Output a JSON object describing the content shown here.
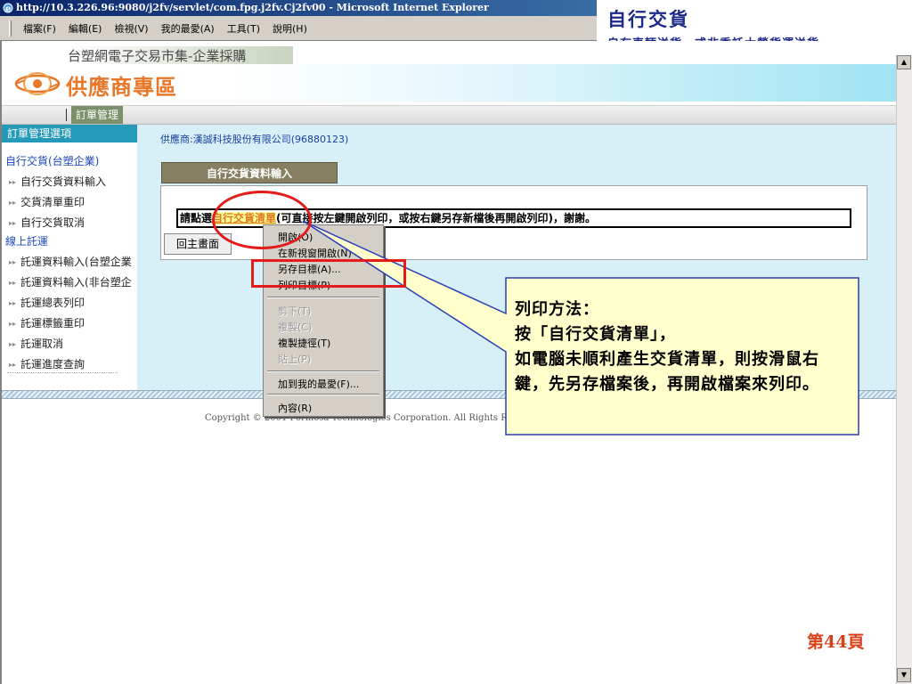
{
  "window": {
    "title": "http://10.3.226.96:9080/j2fv/servlet/com.fpg.j2fv.Cj2fv00 - Microsoft Internet Explorer"
  },
  "menubar": {
    "items": [
      "檔案(F)",
      "編輯(E)",
      "檢視(V)",
      "我的最愛(A)",
      "工具(T)",
      "說明(H)"
    ]
  },
  "slide": {
    "title": "自行交貨",
    "subtitle": "自有車輛送貨、或非委託大榮貨運送貨",
    "page_number": "第44頁"
  },
  "header": {
    "market_title": "台塑網電子交易市集-企業採購",
    "zone_title": "供應商專區",
    "nav_tab": "訂單管理"
  },
  "sidebar": {
    "header": "訂單管理選項",
    "cat1": "自行交貨(台塑企業)",
    "cat1_items": [
      "自行交貨資料輸入",
      "交貨清單重印",
      "自行交貨取消"
    ],
    "cat2": "線上託運",
    "cat2_items": [
      "託運資料輸入(台塑企業",
      "託運資料輸入(非台塑企",
      "託運總表列印",
      "託運標籤重印",
      "託運取消",
      "託運進度查詢"
    ]
  },
  "content": {
    "supplier": "供應商:漢誠科技股份有限公司(96880123)",
    "section_title": "自行交貨資料輸入",
    "instr_prefix": "請點選",
    "instr_link": "自行交貨清單",
    "instr_suffix": "(可直接按左鍵開啟列印，或按右鍵另存新檔後再開啟列印)，謝謝。",
    "back_button": "回主畫面",
    "copyright": "Copyright © 2001 Formosa Technologies Corporation. All Rights Rese"
  },
  "context_menu": {
    "open": "開啟(O)",
    "open_new": "在新視窗開啟(N)",
    "save_target": "另存目標(A)...",
    "print_target": "列印目標(P)",
    "cut": "剪下(T)",
    "copy": "複製(C)",
    "copy_shortcut": "複製捷徑(T)",
    "paste": "貼上(P)",
    "add_favorite": "加到我的最愛(F)...",
    "properties": "內容(R)"
  },
  "callout": {
    "line1": "列印方法：",
    "line2": "按「自行交貨清單」，",
    "line3": "如電腦未順利產生交貨清單，則按滑鼠右鍵，先另存檔案後，再開啟檔案來列印。"
  },
  "colors": {
    "accent_orange": "#e8772a",
    "nav_tab": "#7a8f6a",
    "sidebar_header": "#259ab8",
    "annotation_red": "#e31b1b",
    "callout_fill": "#ffffcc",
    "callout_border": "#2b3fb5"
  }
}
